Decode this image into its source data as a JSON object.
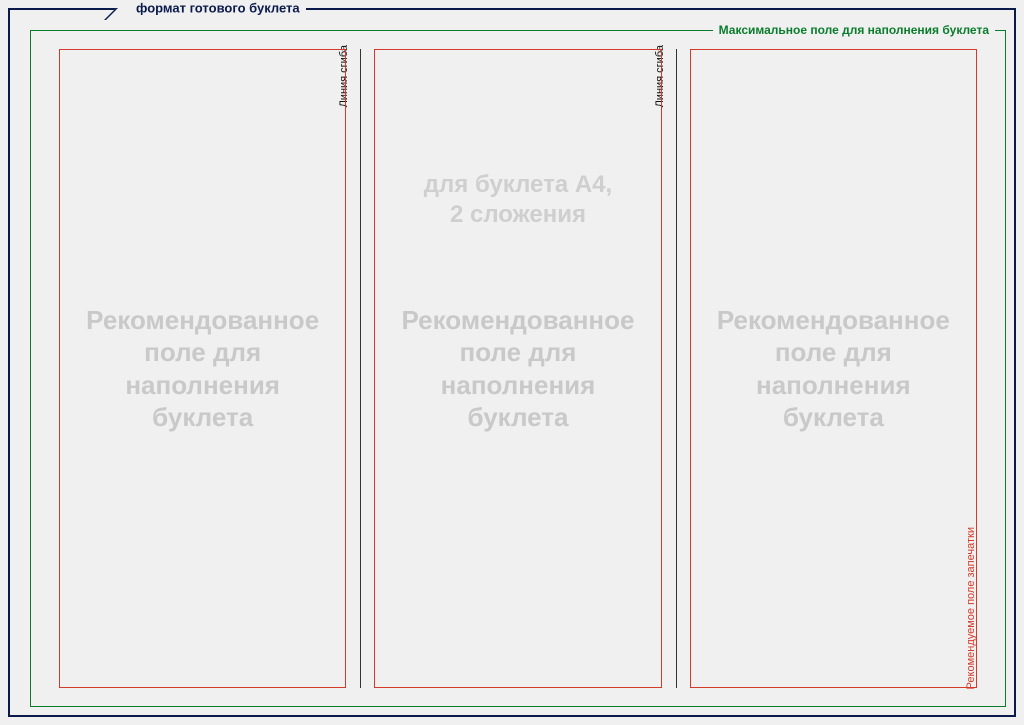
{
  "outer": {
    "label": "формат готового буклета"
  },
  "inner": {
    "label": "Максимальное поле для наполнения буклета"
  },
  "fold": {
    "label": "Линия сгиба"
  },
  "print_area": {
    "label": "Рекомендуемое поле запечатки"
  },
  "center_top": {
    "line1": "для буклета А4,",
    "line2": "2 сложения"
  },
  "panel_text": {
    "line1": "Рекомендованное",
    "line2": "поле для",
    "line3": "наполнения",
    "line4": "буклета"
  },
  "colors": {
    "outer_border": "#0a1a4a",
    "inner_border": "#0a7d2c",
    "panel_border": "#d43a2a",
    "placeholder_text": "#c9c9c9"
  }
}
